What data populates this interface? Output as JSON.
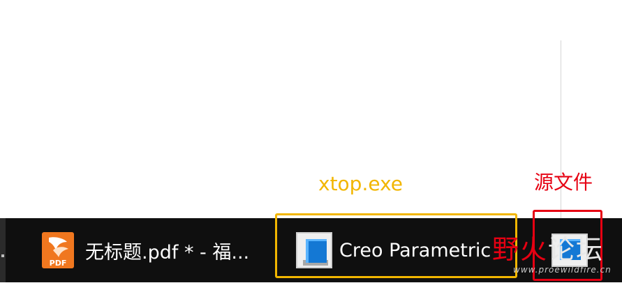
{
  "annotations": {
    "xtop_label": "xtop.exe",
    "source_label": "源文件",
    "xtop_color": "#f2b600",
    "source_color": "#e60012"
  },
  "taskbar": {
    "background": "#0f0f0f",
    "items": [
      {
        "label": "无标题.pdf * - 福...",
        "icon": "foxit-pdf-icon",
        "icon_text": "PDF"
      },
      {
        "label": "Creo Parametric",
        "icon": "creo-parametric-icon"
      },
      {
        "icon": "creo-source-icon"
      }
    ]
  },
  "watermark": {
    "chars": [
      "野",
      "火",
      "论",
      "坛"
    ],
    "url": "www.proewildfire.cn"
  }
}
